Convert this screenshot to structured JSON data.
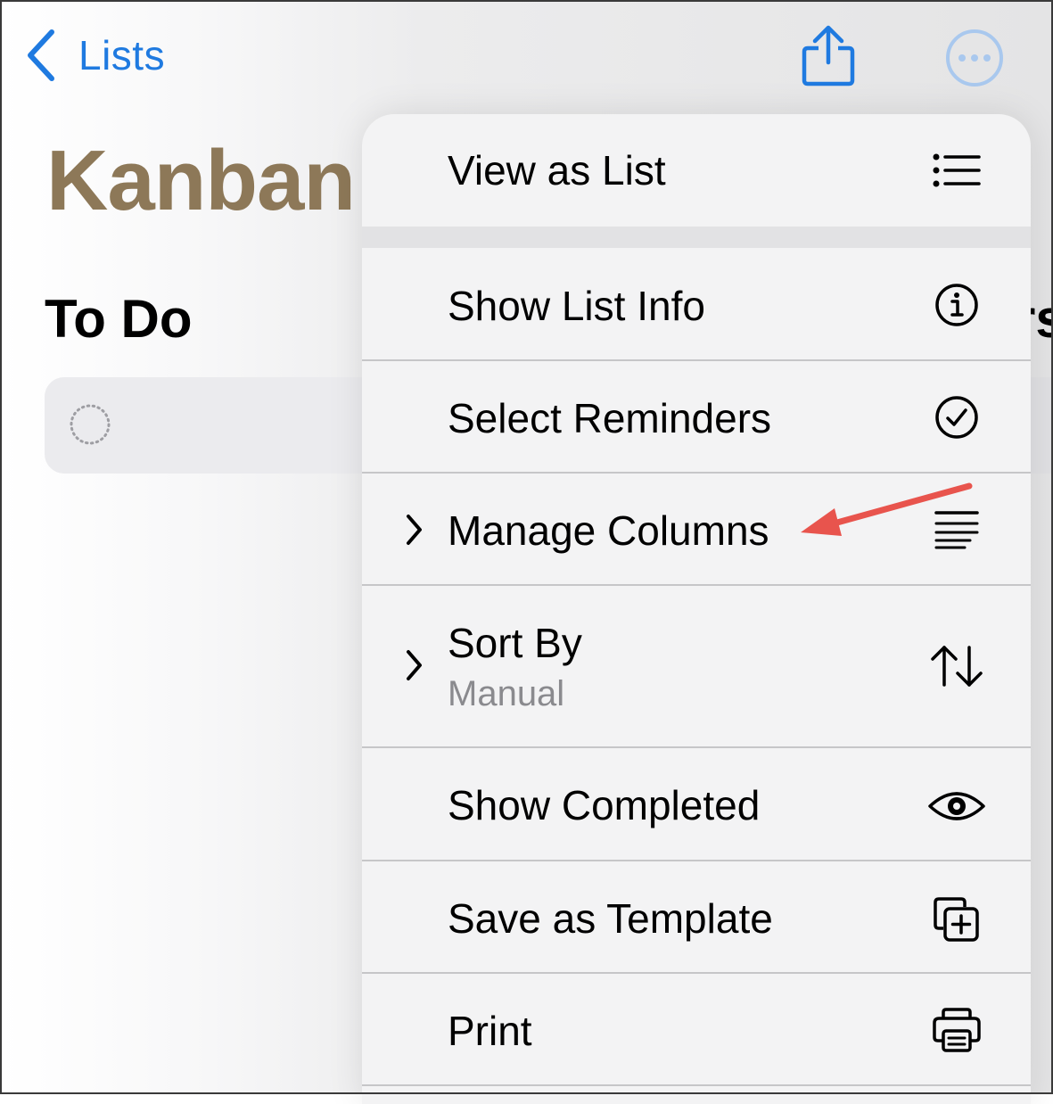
{
  "nav": {
    "back_label": "Lists"
  },
  "page": {
    "title": "Kanban",
    "column_title": "To Do",
    "column_title_partial": "rs"
  },
  "menu": {
    "items": [
      {
        "label": "View as List",
        "icon": "list-bullet-icon"
      },
      {
        "label": "Show List Info",
        "icon": "info-circle-icon"
      },
      {
        "label": "Select Reminders",
        "icon": "checkmark-circle-icon"
      },
      {
        "label": "Manage Columns",
        "icon": "text-align-right-lines-icon",
        "has_submenu": true
      },
      {
        "label": "Sort By",
        "sublabel": "Manual",
        "icon": "sort-arrows-icon",
        "has_submenu": true
      },
      {
        "label": "Show Completed",
        "icon": "eye-icon"
      },
      {
        "label": "Save as Template",
        "icon": "plus-square-on-square-icon"
      },
      {
        "label": "Print",
        "icon": "printer-icon"
      }
    ]
  },
  "colors": {
    "accent": "#1f7ae0",
    "title": "#8d7858",
    "annotation_arrow": "#e8544d"
  }
}
